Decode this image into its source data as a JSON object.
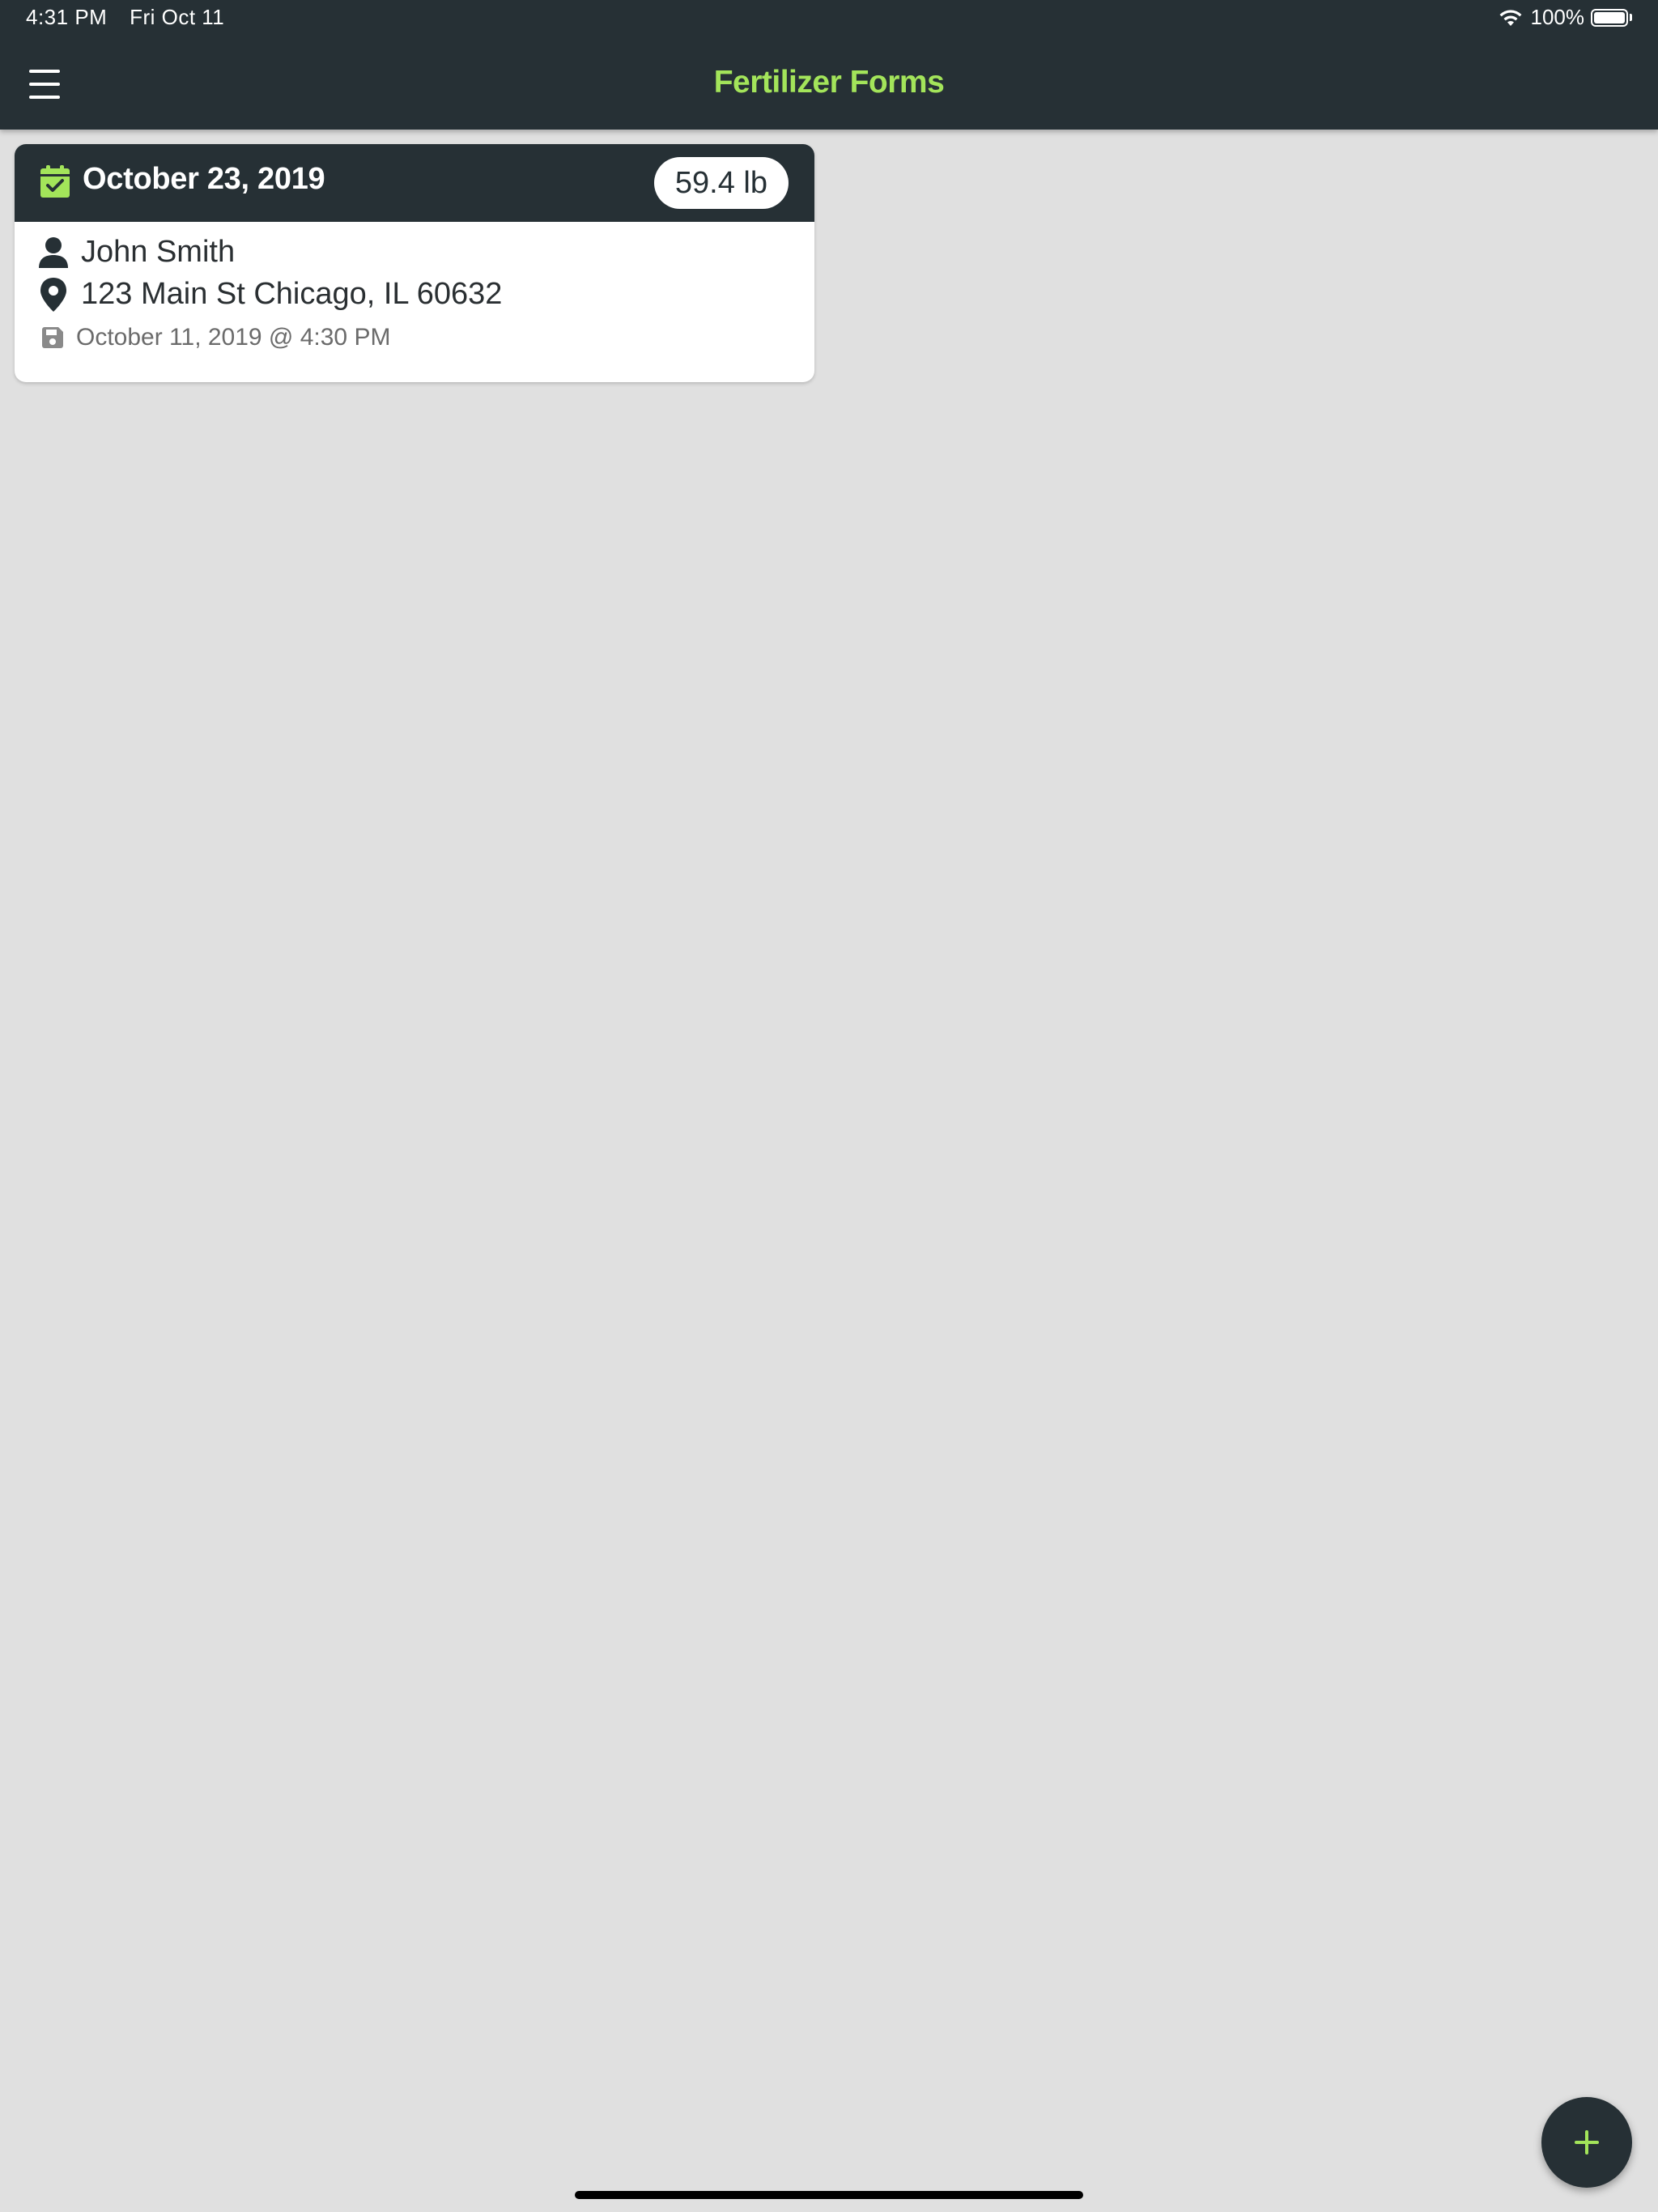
{
  "status_bar": {
    "time": "4:31 PM",
    "date": "Fri Oct 11",
    "battery_percent": "100%",
    "battery_level": 1.0,
    "wifi_icon": "wifi-icon",
    "battery_icon": "battery-icon"
  },
  "app_bar": {
    "title": "Fertilizer Forms",
    "menu_icon": "menu-icon"
  },
  "colors": {
    "bar_background": "#263035",
    "accent": "#a3e45a",
    "page_background": "#e0e0e0",
    "card_background": "#ffffff"
  },
  "forms": [
    {
      "application_date": "October 23, 2019",
      "weight": "59.4 lb",
      "customer_name": "John Smith",
      "address": "123 Main St Chicago, IL 60632",
      "saved_at": "October 11, 2019 @ 4:30 PM",
      "icons": {
        "date": "calendar-check-icon",
        "customer": "person-icon",
        "address": "location-pin-icon",
        "saved": "save-icon"
      }
    }
  ],
  "fab": {
    "icon": "plus-icon"
  }
}
